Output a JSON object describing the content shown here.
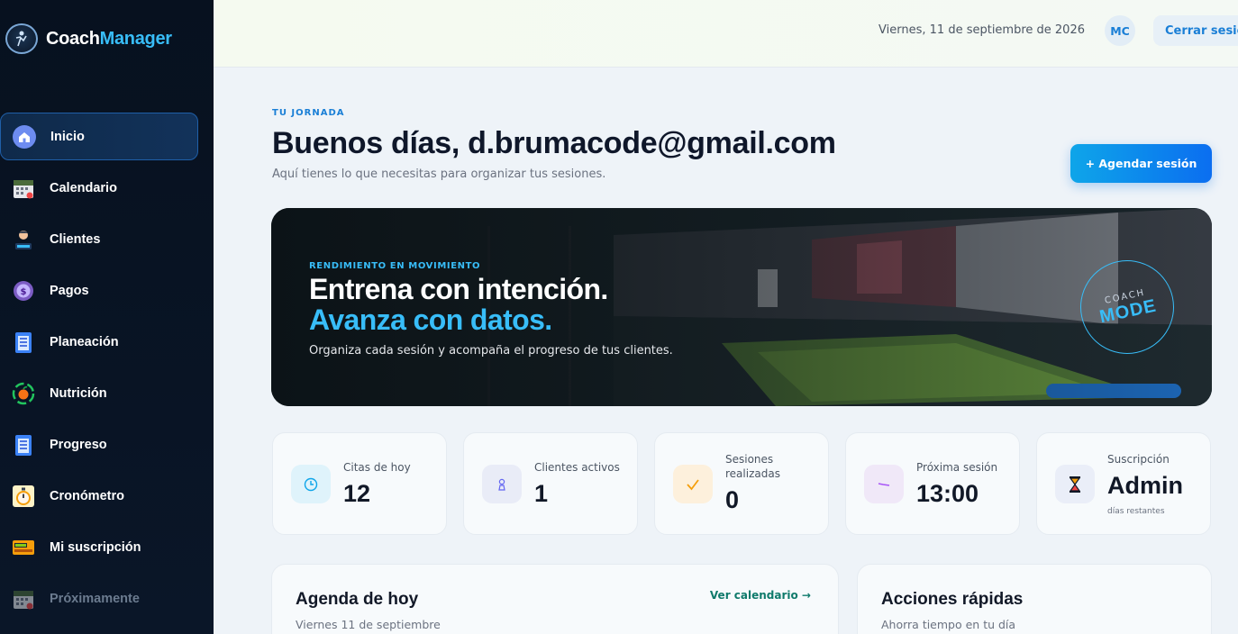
{
  "brand": {
    "name_part1": "Coach",
    "name_part2": "Manager",
    "logo_icon": "coach-logo-icon"
  },
  "sidebar": {
    "items": [
      {
        "label": "Inicio",
        "icon": "home-icon",
        "active": true
      },
      {
        "label": "Calendario",
        "icon": "calendar-icon"
      },
      {
        "label": "Clientes",
        "icon": "clients-icon"
      },
      {
        "label": "Pagos",
        "icon": "payments-icon"
      },
      {
        "label": "Planeación",
        "icon": "checklist-icon"
      },
      {
        "label": "Nutrición",
        "icon": "nutrition-icon"
      },
      {
        "label": "Progreso",
        "icon": "progress-checklist-icon"
      },
      {
        "label": "Cronómetro",
        "icon": "stopwatch-icon"
      },
      {
        "label": "Mi suscripción",
        "icon": "subscription-icon"
      },
      {
        "label": "Próximamente",
        "icon": "calendar-icon",
        "disabled": true
      }
    ]
  },
  "topbar": {
    "date": "Viernes, 11 de septiembre de 2026",
    "avatar_initials": "MC",
    "logout_label": "Cerrar sesión"
  },
  "header": {
    "eyebrow": "TU JORNADA",
    "greeting": "Buenos días, d.brumacode@gmail.com",
    "subtitle": "Aquí tienes lo que necesitas para organizar tus sesiones.",
    "schedule_button": "+ Agendar sesión"
  },
  "hero": {
    "eyebrow": "RENDIMIENTO EN MOVIMIENTO",
    "line1": "Entrena con intención.",
    "line2": "Avanza con datos.",
    "subtitle": "Organiza cada sesión y acompaña el progreso de tus clientes.",
    "badge_small": "COACH",
    "badge_big": "MODE"
  },
  "stats": [
    {
      "label": "Citas de hoy",
      "value": "12",
      "icon": "clock-icon",
      "icon_color": "#0ea5e9"
    },
    {
      "label": "Clientes activos",
      "value": "1",
      "icon": "person-icon",
      "icon_color": "#6366f1"
    },
    {
      "label": "Sesiones realizadas",
      "value": "0",
      "icon": "check-icon",
      "icon_color": "#f59e0b"
    },
    {
      "label": "Próxima sesión",
      "value": "13:00",
      "icon": "trend-icon",
      "icon_color": "#a855f7"
    },
    {
      "label": "Suscripción",
      "value": "Admin",
      "note": "días restantes",
      "icon": "hourglass-icon",
      "icon_color": "#ef4444"
    }
  ],
  "agenda": {
    "title": "Agenda de hoy",
    "subtitle": "Viernes 11 de septiembre",
    "link": "Ver calendario →"
  },
  "quick_actions": {
    "title": "Acciones rápidas",
    "subtitle": "Ahorra tiempo en tu día"
  },
  "colors": {
    "accent": "#38bdf8",
    "primary": "#1a7fd6",
    "sidebar_bg": "#07111f"
  }
}
